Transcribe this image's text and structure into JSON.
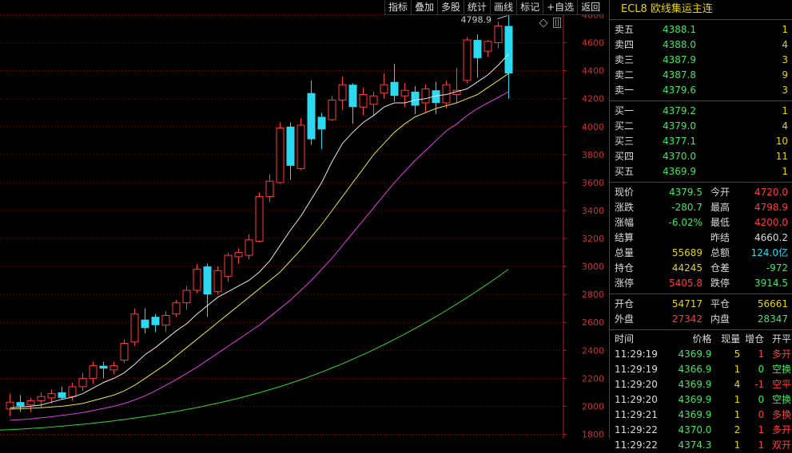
{
  "toolbar": {
    "buttons": [
      "指标",
      "叠加",
      "多股",
      "统计",
      "画线",
      "标记",
      "+自选",
      "返回"
    ]
  },
  "chart": {
    "y_ticks": [
      "4800",
      "4600",
      "4400",
      "4200",
      "4000",
      "3800",
      "3600",
      "3400",
      "3200",
      "3000",
      "2800",
      "2600",
      "2400",
      "2200",
      "2000",
      "1800"
    ],
    "peak_label": "4798.9"
  },
  "chart_data": {
    "type": "candlestick",
    "title": "ECL8 欧线集运主连",
    "ylim": [
      1780,
      4860
    ],
    "candles": [
      {
        "o": 1980,
        "h": 2090,
        "l": 1930,
        "c": 2030
      },
      {
        "o": 2030,
        "h": 2080,
        "l": 1960,
        "c": 2000
      },
      {
        "o": 2010,
        "h": 2060,
        "l": 1960,
        "c": 2040
      },
      {
        "o": 2040,
        "h": 2100,
        "l": 1990,
        "c": 2070
      },
      {
        "o": 2060,
        "h": 2120,
        "l": 2020,
        "c": 2090
      },
      {
        "o": 2100,
        "h": 2140,
        "l": 2050,
        "c": 2060
      },
      {
        "o": 2070,
        "h": 2170,
        "l": 2040,
        "c": 2140
      },
      {
        "o": 2140,
        "h": 2240,
        "l": 2110,
        "c": 2200
      },
      {
        "o": 2200,
        "h": 2320,
        "l": 2160,
        "c": 2290
      },
      {
        "o": 2290,
        "h": 2320,
        "l": 2200,
        "c": 2270
      },
      {
        "o": 2260,
        "h": 2320,
        "l": 2230,
        "c": 2290
      },
      {
        "o": 2330,
        "h": 2480,
        "l": 2310,
        "c": 2450
      },
      {
        "o": 2460,
        "h": 2700,
        "l": 2430,
        "c": 2660
      },
      {
        "o": 2620,
        "h": 2700,
        "l": 2520,
        "c": 2560
      },
      {
        "o": 2640,
        "h": 2660,
        "l": 2530,
        "c": 2580
      },
      {
        "o": 2580,
        "h": 2680,
        "l": 2530,
        "c": 2650
      },
      {
        "o": 2660,
        "h": 2760,
        "l": 2640,
        "c": 2740
      },
      {
        "o": 2740,
        "h": 2860,
        "l": 2690,
        "c": 2830
      },
      {
        "o": 2830,
        "h": 3020,
        "l": 2810,
        "c": 2980
      },
      {
        "o": 3000,
        "h": 3020,
        "l": 2640,
        "c": 2800
      },
      {
        "o": 2820,
        "h": 3000,
        "l": 2800,
        "c": 2970
      },
      {
        "o": 2930,
        "h": 3100,
        "l": 2890,
        "c": 3080
      },
      {
        "o": 3070,
        "h": 3130,
        "l": 3020,
        "c": 3100
      },
      {
        "o": 3080,
        "h": 3230,
        "l": 3050,
        "c": 3190
      },
      {
        "o": 3180,
        "h": 3530,
        "l": 3170,
        "c": 3500
      },
      {
        "o": 3500,
        "h": 3660,
        "l": 3460,
        "c": 3610
      },
      {
        "o": 3600,
        "h": 4030,
        "l": 3590,
        "c": 3990
      },
      {
        "o": 4000,
        "h": 4030,
        "l": 3620,
        "c": 3720
      },
      {
        "o": 3700,
        "h": 4060,
        "l": 3690,
        "c": 4010
      },
      {
        "o": 4240,
        "h": 4330,
        "l": 3870,
        "c": 3910
      },
      {
        "o": 4070,
        "h": 4100,
        "l": 3840,
        "c": 3980
      },
      {
        "o": 4050,
        "h": 4220,
        "l": 4040,
        "c": 4190
      },
      {
        "o": 4190,
        "h": 4360,
        "l": 4120,
        "c": 4300
      },
      {
        "o": 4300,
        "h": 4310,
        "l": 4020,
        "c": 4140
      },
      {
        "o": 4140,
        "h": 4280,
        "l": 4080,
        "c": 4230
      },
      {
        "o": 4160,
        "h": 4250,
        "l": 4080,
        "c": 4220
      },
      {
        "o": 4240,
        "h": 4380,
        "l": 4200,
        "c": 4300
      },
      {
        "o": 4320,
        "h": 4450,
        "l": 4180,
        "c": 4220
      },
      {
        "o": 4220,
        "h": 4310,
        "l": 4140,
        "c": 4260
      },
      {
        "o": 4250,
        "h": 4290,
        "l": 4090,
        "c": 4150
      },
      {
        "o": 4170,
        "h": 4300,
        "l": 4100,
        "c": 4270
      },
      {
        "o": 4260,
        "h": 4320,
        "l": 4090,
        "c": 4170
      },
      {
        "o": 4170,
        "h": 4330,
        "l": 4130,
        "c": 4300
      },
      {
        "o": 4230,
        "h": 4420,
        "l": 4170,
        "c": 4260
      },
      {
        "o": 4330,
        "h": 4640,
        "l": 4310,
        "c": 4620
      },
      {
        "o": 4620,
        "h": 4660,
        "l": 4350,
        "c": 4490
      },
      {
        "o": 4540,
        "h": 4620,
        "l": 4500,
        "c": 4610
      },
      {
        "o": 4600,
        "h": 4750,
        "l": 4560,
        "c": 4720
      },
      {
        "o": 4720,
        "h": 4799,
        "l": 4200,
        "c": 4380
      }
    ],
    "ma_series": [
      {
        "color": "#e6e6e6",
        "values": [
          1990,
          1995,
          2000,
          2010,
          2030,
          2050,
          2065,
          2090,
          2130,
          2170,
          2200,
          2240,
          2300,
          2370,
          2420,
          2480,
          2540,
          2590,
          2660,
          2720,
          2780,
          2820,
          2860,
          2900,
          2960,
          3040,
          3150,
          3260,
          3360,
          3480,
          3600,
          3750,
          3880,
          3960,
          4030,
          4080,
          4140,
          4170,
          4170,
          4190,
          4200,
          4220,
          4230,
          4250,
          4270,
          4320,
          4370,
          4440,
          4520
        ]
      },
      {
        "color": "#e8e34a",
        "values": [
          1980,
          1983,
          1986,
          1990,
          1995,
          2000,
          2010,
          2020,
          2040,
          2060,
          2080,
          2110,
          2150,
          2200,
          2250,
          2300,
          2360,
          2420,
          2480,
          2540,
          2600,
          2660,
          2720,
          2780,
          2840,
          2900,
          2960,
          3040,
          3120,
          3210,
          3300,
          3400,
          3500,
          3600,
          3700,
          3800,
          3880,
          3960,
          4020,
          4070,
          4100,
          4130,
          4150,
          4170,
          4200,
          4230,
          4280,
          4330,
          4380
        ]
      },
      {
        "color": "#e03ee0",
        "values": [
          1900,
          1905,
          1910,
          1918,
          1925,
          1935,
          1945,
          1955,
          1970,
          1985,
          2000,
          2020,
          2045,
          2075,
          2110,
          2150,
          2190,
          2235,
          2280,
          2330,
          2380,
          2430,
          2480,
          2530,
          2580,
          2640,
          2700,
          2760,
          2830,
          2900,
          2980,
          3060,
          3150,
          3240,
          3330,
          3420,
          3510,
          3600,
          3680,
          3760,
          3830,
          3900,
          3970,
          4020,
          4080,
          4130,
          4170,
          4210,
          4250
        ]
      },
      {
        "color": "#33d433",
        "values": [
          1830,
          1833,
          1836,
          1840,
          1844,
          1848,
          1853,
          1858,
          1864,
          1870,
          1876,
          1883,
          1890,
          1898,
          1906,
          1915,
          1924,
          1934,
          1944,
          1955,
          1966,
          1978,
          1990,
          2003,
          2017,
          2031,
          2046,
          2062,
          2079,
          2096,
          2114,
          2133,
          2153,
          2174,
          2196,
          2219,
          2243,
          2268,
          2294,
          2321,
          2349,
          2378,
          2408,
          2439,
          2471,
          2504,
          2538,
          2573,
          2609,
          2646,
          2684,
          2723,
          2763,
          2804,
          2846,
          2889,
          2933,
          2980
        ]
      }
    ]
  },
  "side": {
    "title": "ECL8 欧线集运主连",
    "asks": [
      {
        "label": "卖五",
        "price": "4388.1",
        "vol": "1"
      },
      {
        "label": "卖四",
        "price": "4388.0",
        "vol": "4"
      },
      {
        "label": "卖三",
        "price": "4387.9",
        "vol": "3"
      },
      {
        "label": "卖二",
        "price": "4387.8",
        "vol": "9"
      },
      {
        "label": "卖一",
        "price": "4379.6",
        "vol": "3"
      }
    ],
    "bids": [
      {
        "label": "买一",
        "price": "4379.2",
        "vol": "1"
      },
      {
        "label": "买二",
        "price": "4379.0",
        "vol": "4"
      },
      {
        "label": "买三",
        "price": "4377.1",
        "vol": "10"
      },
      {
        "label": "买四",
        "price": "4370.0",
        "vol": "11"
      },
      {
        "label": "买五",
        "price": "4369.9",
        "vol": "1"
      }
    ],
    "stats1": [
      {
        "k": "现价",
        "v": "4379.5",
        "vc": "green",
        "k2": "今开",
        "v2": "4720.0",
        "v2c": "red"
      },
      {
        "k": "涨跌",
        "v": "-280.7",
        "vc": "green",
        "k2": "最高",
        "v2": "4798.9",
        "v2c": "red"
      },
      {
        "k": "涨幅",
        "v": "-6.02%",
        "vc": "green",
        "k2": "最低",
        "v2": "4200.0",
        "v2c": "red"
      },
      {
        "k": "结算",
        "v": "",
        "vc": "white",
        "k2": "昨结",
        "v2": "4660.2",
        "v2c": "white"
      },
      {
        "k": "总量",
        "v": "55689",
        "vc": "yellow",
        "k2": "总额",
        "v2": "124.0亿",
        "v2c": "cyan"
      },
      {
        "k": "持仓",
        "v": "44245",
        "vc": "yellow",
        "k2": "仓差",
        "v2": "-972",
        "v2c": "green"
      },
      {
        "k": "涨停",
        "v": "5405.8",
        "vc": "red",
        "k2": "跌停",
        "v2": "3914.5",
        "v2c": "green"
      }
    ],
    "stats2": [
      {
        "k": "开仓",
        "v": "54717",
        "vc": "yellow",
        "k2": "平仓",
        "v2": "56661",
        "v2c": "yellow"
      },
      {
        "k": "外盘",
        "v": "27342",
        "vc": "red",
        "k2": "内盘",
        "v2": "28347",
        "v2c": "green"
      }
    ],
    "tick_headers": {
      "time": "时间",
      "price": "价格",
      "vol": "现量",
      "chg": "增仓",
      "type": "开平"
    },
    "ticks": [
      {
        "time": "11:29:19",
        "price": "4369.9",
        "vol": "5",
        "chg": "1",
        "type": "多开",
        "tc": "red",
        "cc": "red"
      },
      {
        "time": "11:29:19",
        "price": "4366.9",
        "vol": "1",
        "chg": "0",
        "type": "空换",
        "tc": "green",
        "cc": "green"
      },
      {
        "time": "11:29:20",
        "price": "4369.9",
        "vol": "4",
        "chg": "-1",
        "type": "空平",
        "tc": "red",
        "cc": "red"
      },
      {
        "time": "11:29:20",
        "price": "4369.9",
        "vol": "1",
        "chg": "0",
        "type": "空换",
        "tc": "green",
        "cc": "green"
      },
      {
        "time": "11:29:21",
        "price": "4369.9",
        "vol": "1",
        "chg": "0",
        "type": "多换",
        "tc": "red",
        "cc": "red"
      },
      {
        "time": "11:29:22",
        "price": "4370.0",
        "vol": "2",
        "chg": "1",
        "type": "多开",
        "tc": "red",
        "cc": "red"
      },
      {
        "time": "11:29:22",
        "price": "4374.3",
        "vol": "1",
        "chg": "1",
        "type": "双开",
        "tc": "red",
        "cc": "red"
      }
    ]
  }
}
